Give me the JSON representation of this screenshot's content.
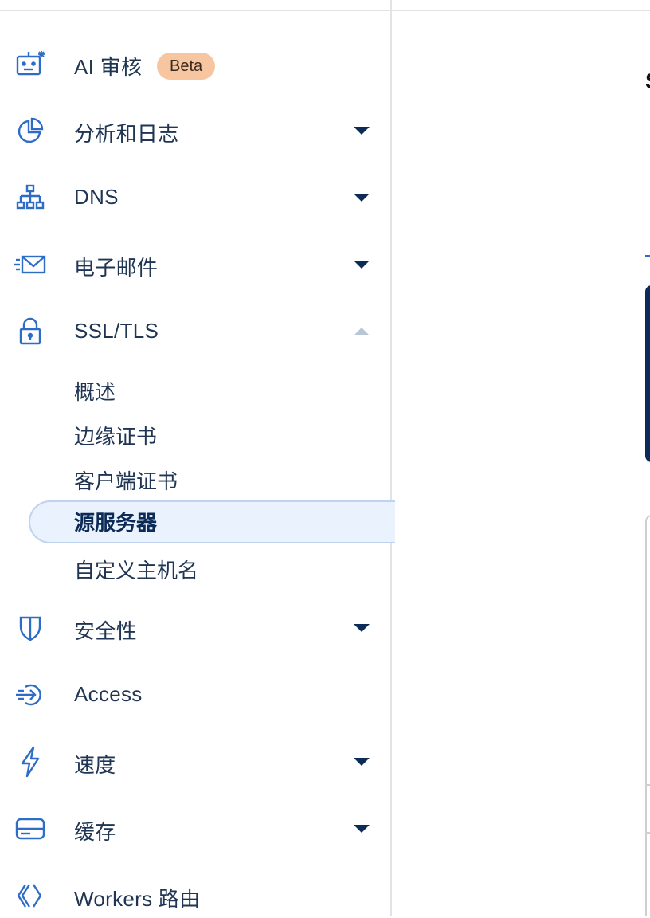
{
  "sidebar": {
    "ai_audit": {
      "label": "AI 审核",
      "badge": "Beta",
      "icon": "robot-icon"
    },
    "analytics": {
      "label": "分析和日志",
      "icon": "pie-chart-icon"
    },
    "dns": {
      "label": "DNS",
      "icon": "sitemap-icon"
    },
    "email": {
      "label": "电子邮件",
      "icon": "envelope-icon"
    },
    "ssl": {
      "label": "SSL/TLS",
      "icon": "lock-icon",
      "expanded": true,
      "sub_items": [
        "概述",
        "边缘证书",
        "客户端证书",
        "源服务器",
        "自定义主机名"
      ],
      "active_sub": "源服务器"
    },
    "security": {
      "label": "安全性",
      "icon": "shield-icon"
    },
    "access": {
      "label": "Access",
      "icon": "sign-in-icon"
    },
    "speed": {
      "label": "速度",
      "icon": "bolt-icon"
    },
    "caching": {
      "label": "缓存",
      "icon": "server-stack-icon"
    },
    "workers": {
      "label": "Workers 路由",
      "icon": "code-brackets-icon"
    }
  },
  "colors": {
    "brand_blue": "#0d2b57",
    "icon_blue": "#2d6dc8",
    "active_bg": "#eaf2fd",
    "beta_badge": "#f7c6a0"
  },
  "main": {
    "heading_fragment": "S"
  }
}
